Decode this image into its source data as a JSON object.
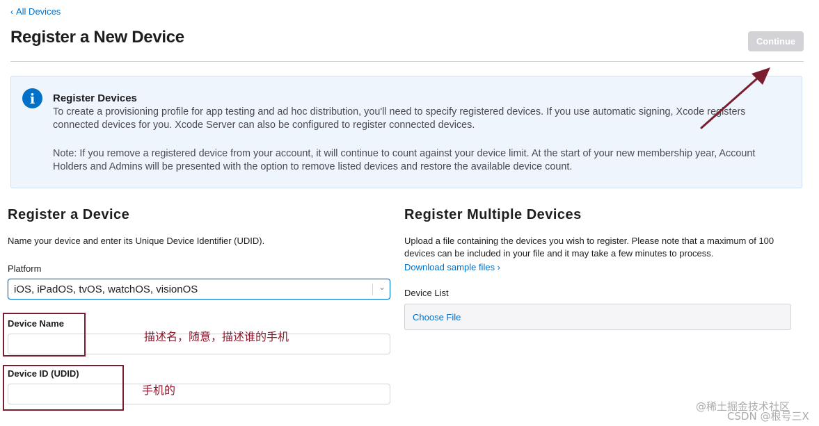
{
  "header": {
    "back_link": "All Devices",
    "title": "Register a New Device",
    "continue_label": "Continue"
  },
  "info": {
    "title": "Register Devices",
    "paragraph1": "To create a provisioning profile for app testing and ad hoc distribution, you'll need to specify registered devices. If you use automatic signing, Xcode registers connected devices for you. Xcode Server can also be configured to register connected devices.",
    "paragraph2": "Note: If you remove a registered device from your account, it will continue to count against your device limit. At the start of your new membership year, Account Holders and Admins will be presented with the option to remove listed devices and restore the available device count."
  },
  "register_device": {
    "title": "Register a Device",
    "description": "Name your device and enter its Unique Device Identifier (UDID).",
    "platform_label": "Platform",
    "platform_value": "iOS, iPadOS, tvOS, watchOS, visionOS",
    "device_name_label": "Device Name",
    "device_name_value": "",
    "device_id_label": "Device ID (UDID)",
    "device_id_value": ""
  },
  "register_multiple": {
    "title": "Register Multiple Devices",
    "description": "Upload a file containing the devices you wish to register. Please note that a maximum of 100 devices can be included in your file and it may take a few minutes to process.",
    "sample_link": "Download sample files ›",
    "device_list_label": "Device List",
    "choose_file": "Choose File"
  },
  "annotations": {
    "device_name_note": "描述名，随意，描述谁的手机",
    "device_id_note": "手机的",
    "color": "#7a1d2e"
  },
  "watermark": {
    "line1": "@稀土掘金技术社区",
    "line2": "CSDN @根号三X"
  },
  "colors": {
    "accent": "#0070c9",
    "disabled_button": "#d2d2d7",
    "info_background": "#eef5fc"
  }
}
